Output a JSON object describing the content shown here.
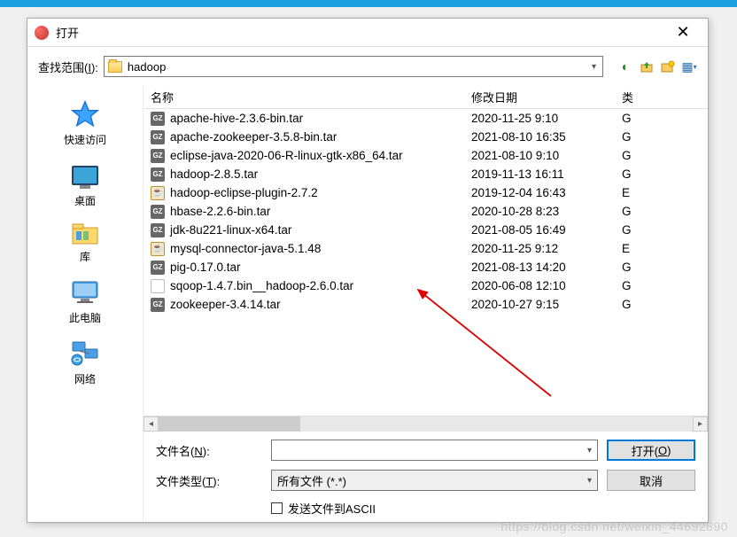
{
  "dialog": {
    "title": "打开",
    "close_glyph": "✕"
  },
  "lookin": {
    "label_pre": "查找范围(",
    "label_key": "I",
    "label_post": "):",
    "folder": "hadoop"
  },
  "toolbar_icons": {
    "back": "⬅",
    "up": "↑",
    "new_folder": "📁",
    "view": "▦"
  },
  "sidebar": {
    "places": [
      {
        "id": "quick",
        "label": "快速访问"
      },
      {
        "id": "desktop",
        "label": "桌面"
      },
      {
        "id": "libraries",
        "label": "库"
      },
      {
        "id": "thispc",
        "label": "此电脑"
      },
      {
        "id": "network",
        "label": "网络"
      }
    ]
  },
  "columns": {
    "name": "名称",
    "date": "修改日期",
    "type": "类"
  },
  "files": [
    {
      "icon": "gz",
      "name": "apache-hive-2.3.6-bin.tar",
      "date": "2020-11-25 9:10",
      "type": "G"
    },
    {
      "icon": "gz",
      "name": "apache-zookeeper-3.5.8-bin.tar",
      "date": "2021-08-10 16:35",
      "type": "G"
    },
    {
      "icon": "gz",
      "name": "eclipse-java-2020-06-R-linux-gtk-x86_64.tar",
      "date": "2021-08-10 9:10",
      "type": "G"
    },
    {
      "icon": "gz",
      "name": "hadoop-2.8.5.tar",
      "date": "2019-11-13 16:11",
      "type": "G"
    },
    {
      "icon": "jar",
      "name": "hadoop-eclipse-plugin-2.7.2",
      "date": "2019-12-04 16:43",
      "type": "E"
    },
    {
      "icon": "gz",
      "name": "hbase-2.2.6-bin.tar",
      "date": "2020-10-28 8:23",
      "type": "G"
    },
    {
      "icon": "gz",
      "name": "jdk-8u221-linux-x64.tar",
      "date": "2021-08-05 16:49",
      "type": "G"
    },
    {
      "icon": "jar",
      "name": "mysql-connector-java-5.1.48",
      "date": "2020-11-25 9:12",
      "type": "E"
    },
    {
      "icon": "gz",
      "name": "pig-0.17.0.tar",
      "date": "2021-08-13 14:20",
      "type": "G"
    },
    {
      "icon": "blank",
      "name": "sqoop-1.4.7.bin__hadoop-2.6.0.tar",
      "date": "2020-06-08 12:10",
      "type": "G"
    },
    {
      "icon": "gz",
      "name": "zookeeper-3.4.14.tar",
      "date": "2020-10-27 9:15",
      "type": "G"
    }
  ],
  "form": {
    "filename_label_pre": "文件名(",
    "filename_key": "N",
    "filename_label_post": "):",
    "filename_value": "",
    "filetype_label_pre": "文件类型(",
    "filetype_key": "T",
    "filetype_label_post": "):",
    "filetype_value": "所有文件 (*.*)",
    "open_btn_pre": "打开(",
    "open_key": "O",
    "open_btn_post": ")",
    "cancel_btn": "取消",
    "ascii_label": "发送文件到ASCII"
  },
  "watermark": "https://blog.csdn.net/weixin_44692890"
}
